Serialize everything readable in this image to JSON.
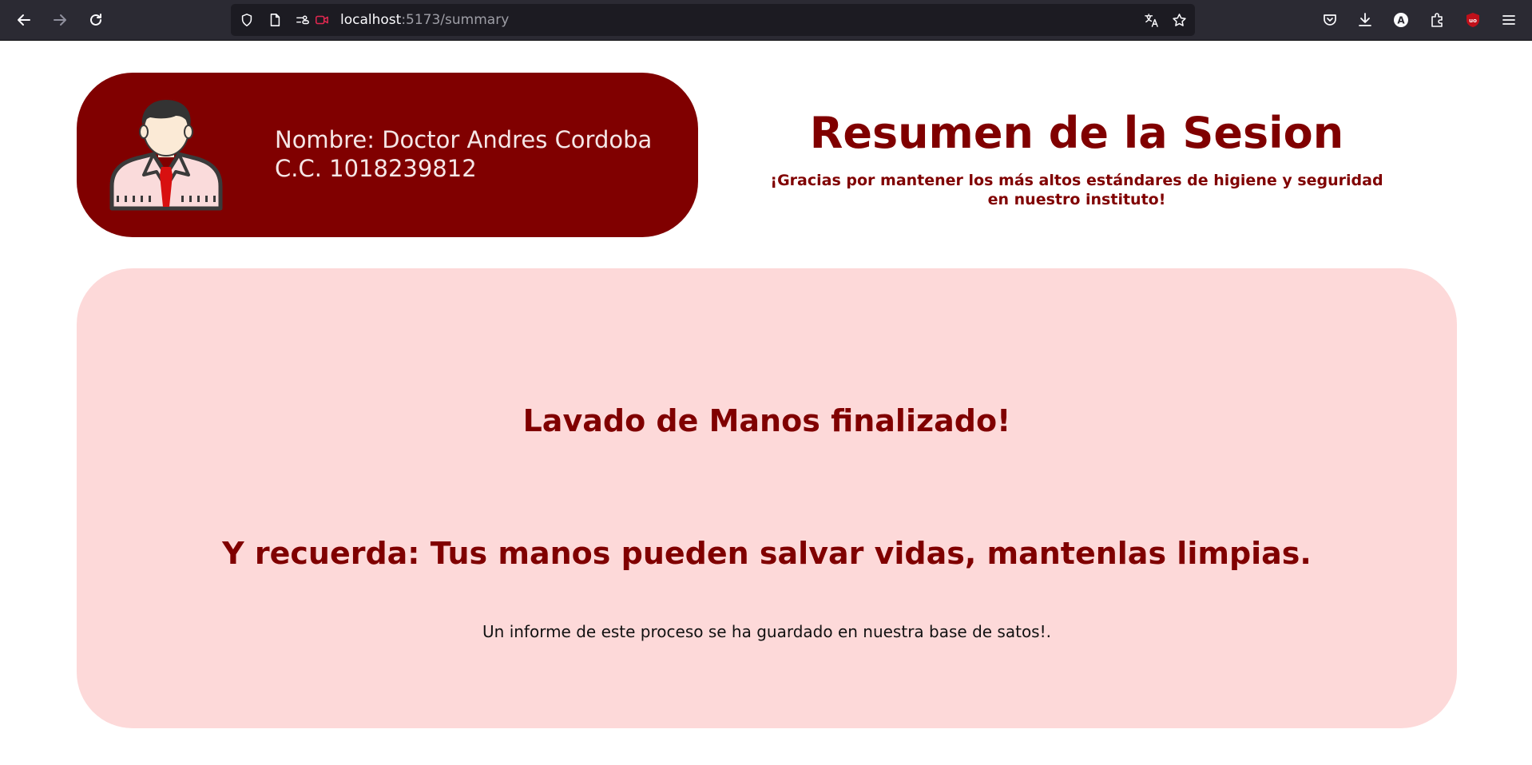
{
  "browser": {
    "url_host": "localhost",
    "url_path": ":5173/summary",
    "icons": [
      "back-icon",
      "forward-icon",
      "reload-icon",
      "shield-icon",
      "page-icon",
      "permissions-icon",
      "camera-icon",
      "translate-icon",
      "star-icon",
      "pocket-icon",
      "download-icon",
      "account-icon",
      "extensions-icon",
      "ublock-icon",
      "menu-icon"
    ]
  },
  "profile": {
    "name_line": "Nombre: Doctor Andres Cordoba",
    "id_line": "C.C. 1018239812",
    "avatar_icon": "doctor-avatar-icon"
  },
  "header": {
    "title": "Resumen de la Sesion",
    "subtitle": "¡Gracias por mantener los más altos estándares de higiene y seguridad en nuestro instituto!"
  },
  "summary": {
    "finished": "Lavado de Manos finalizado!",
    "remember": "Y recuerda: Tus manos pueden salvar vidas, mantenlas limpias.",
    "report": "Un informe de este proceso se ha guardado en nuestra base de satos!."
  },
  "colors": {
    "brand": "#800000",
    "card_bg": "#fdd9d9",
    "chrome_bg": "#2b2a33"
  }
}
